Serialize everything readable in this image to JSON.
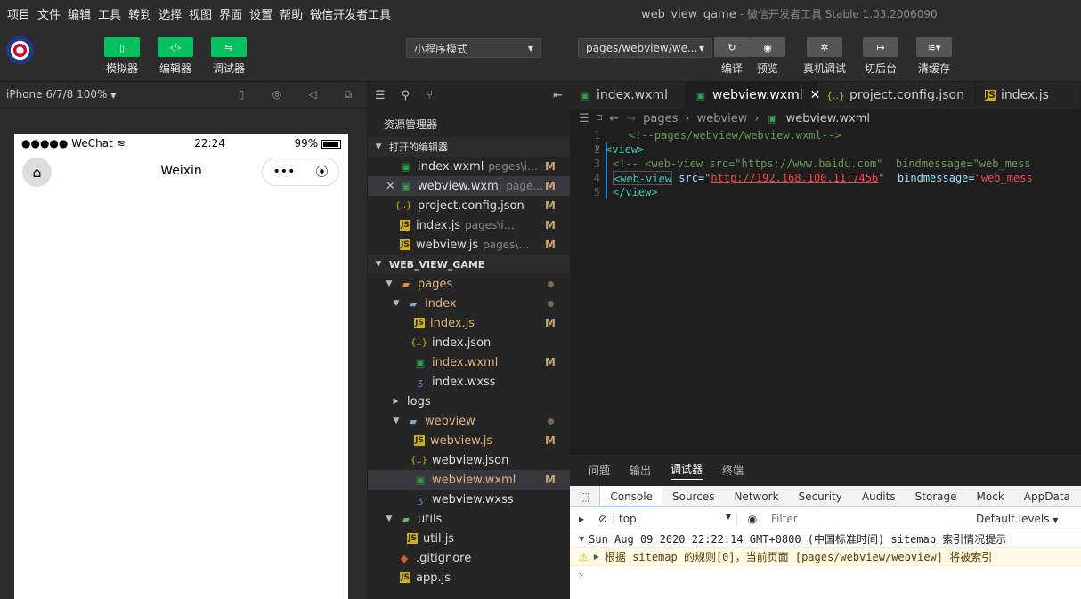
{
  "menubar": {
    "items": [
      "项目",
      "文件",
      "编辑",
      "工具",
      "转到",
      "选择",
      "视图",
      "界面",
      "设置",
      "帮助",
      "微信开发者工具"
    ],
    "title": "web_view_game",
    "subtitle": "- 微信开发者工具 Stable 1.03.2006090"
  },
  "toolbar": {
    "simulator": "模拟器",
    "editor": "编辑器",
    "debugger": "调试器",
    "mode": "小程序模式",
    "page_path": "pages/webview/we...",
    "compile": "编译",
    "preview": "预览",
    "remote_debug": "真机调试",
    "background": "切后台",
    "clear_cache": "清缓存"
  },
  "simulator": {
    "device": "iPhone 6/7/8 100%",
    "carrier": "●●●●● WeChat",
    "time": "22:24",
    "battery": "99%",
    "nav_title": "Weixin",
    "capsule_more": "•••"
  },
  "explorer": {
    "title": "资源管理器",
    "open_editors_label": "打开的编辑器",
    "project_label": "WEB_VIEW_GAME",
    "open_editors": [
      {
        "name": "index.wxml",
        "path": "pages\\in...",
        "status": "M"
      },
      {
        "name": "webview.wxml",
        "path": "page...",
        "status": "M"
      },
      {
        "name": "project.config.json",
        "path": "",
        "status": "M"
      },
      {
        "name": "index.js",
        "path": "pages\\index",
        "status": "M"
      },
      {
        "name": "webview.js",
        "path": "pages\\we...",
        "status": "M"
      }
    ],
    "tree": [
      {
        "name": "pages"
      },
      {
        "name": "index"
      },
      {
        "name": "index.js",
        "status": "M"
      },
      {
        "name": "index.json"
      },
      {
        "name": "index.wxml",
        "status": "M"
      },
      {
        "name": "index.wxss"
      },
      {
        "name": "logs"
      },
      {
        "name": "webview"
      },
      {
        "name": "webview.js",
        "status": "M"
      },
      {
        "name": "webview.json"
      },
      {
        "name": "webview.wxml",
        "status": "M"
      },
      {
        "name": "webview.wxss"
      },
      {
        "name": "utils"
      },
      {
        "name": "util.js"
      },
      {
        "name": ".gitignore"
      },
      {
        "name": "app.js"
      }
    ]
  },
  "editor": {
    "tabs": [
      "index.wxml",
      "webview.wxml",
      "project.config.json",
      "index.js"
    ],
    "breadcrumbs": [
      "pages",
      "webview",
      "webview.wxml"
    ],
    "lines": {
      "l1": "<!--pages/webview/webview.wxml-->",
      "l2": "<view>",
      "l3_a": "<!-- <web-view src=\"https://www.baidu.com\"  bindmessage=\"web_mess",
      "l4_tag": "<web-view",
      "l4_attr": " src=",
      "l4_q1": "\"",
      "l4_url": "http://192.168.100.11:7456",
      "l4_q2": "\"",
      "l4_attr2": "  bindmessage=",
      "l4_str2": "\"web_mess",
      "l5": "</view>"
    },
    "line_numbers": [
      "1",
      "2",
      "3",
      "4",
      "5"
    ]
  },
  "panel": {
    "tabs": [
      "问题",
      "输出",
      "调试器",
      "终端"
    ],
    "devtools_tabs": [
      "Console",
      "Sources",
      "Network",
      "Security",
      "Audits",
      "Storage",
      "Mock",
      "AppData",
      "Se"
    ],
    "context": "top",
    "filter_placeholder": "Filter",
    "levels": "Default levels",
    "log_header": "Sun Aug 09 2020 22:22:14 GMT+0800 (中国标准时间) sitemap 索引情况提示",
    "log_warn": "根据 sitemap 的规则[0]，当前页面 [pages/webview/webview] 将被索引"
  }
}
